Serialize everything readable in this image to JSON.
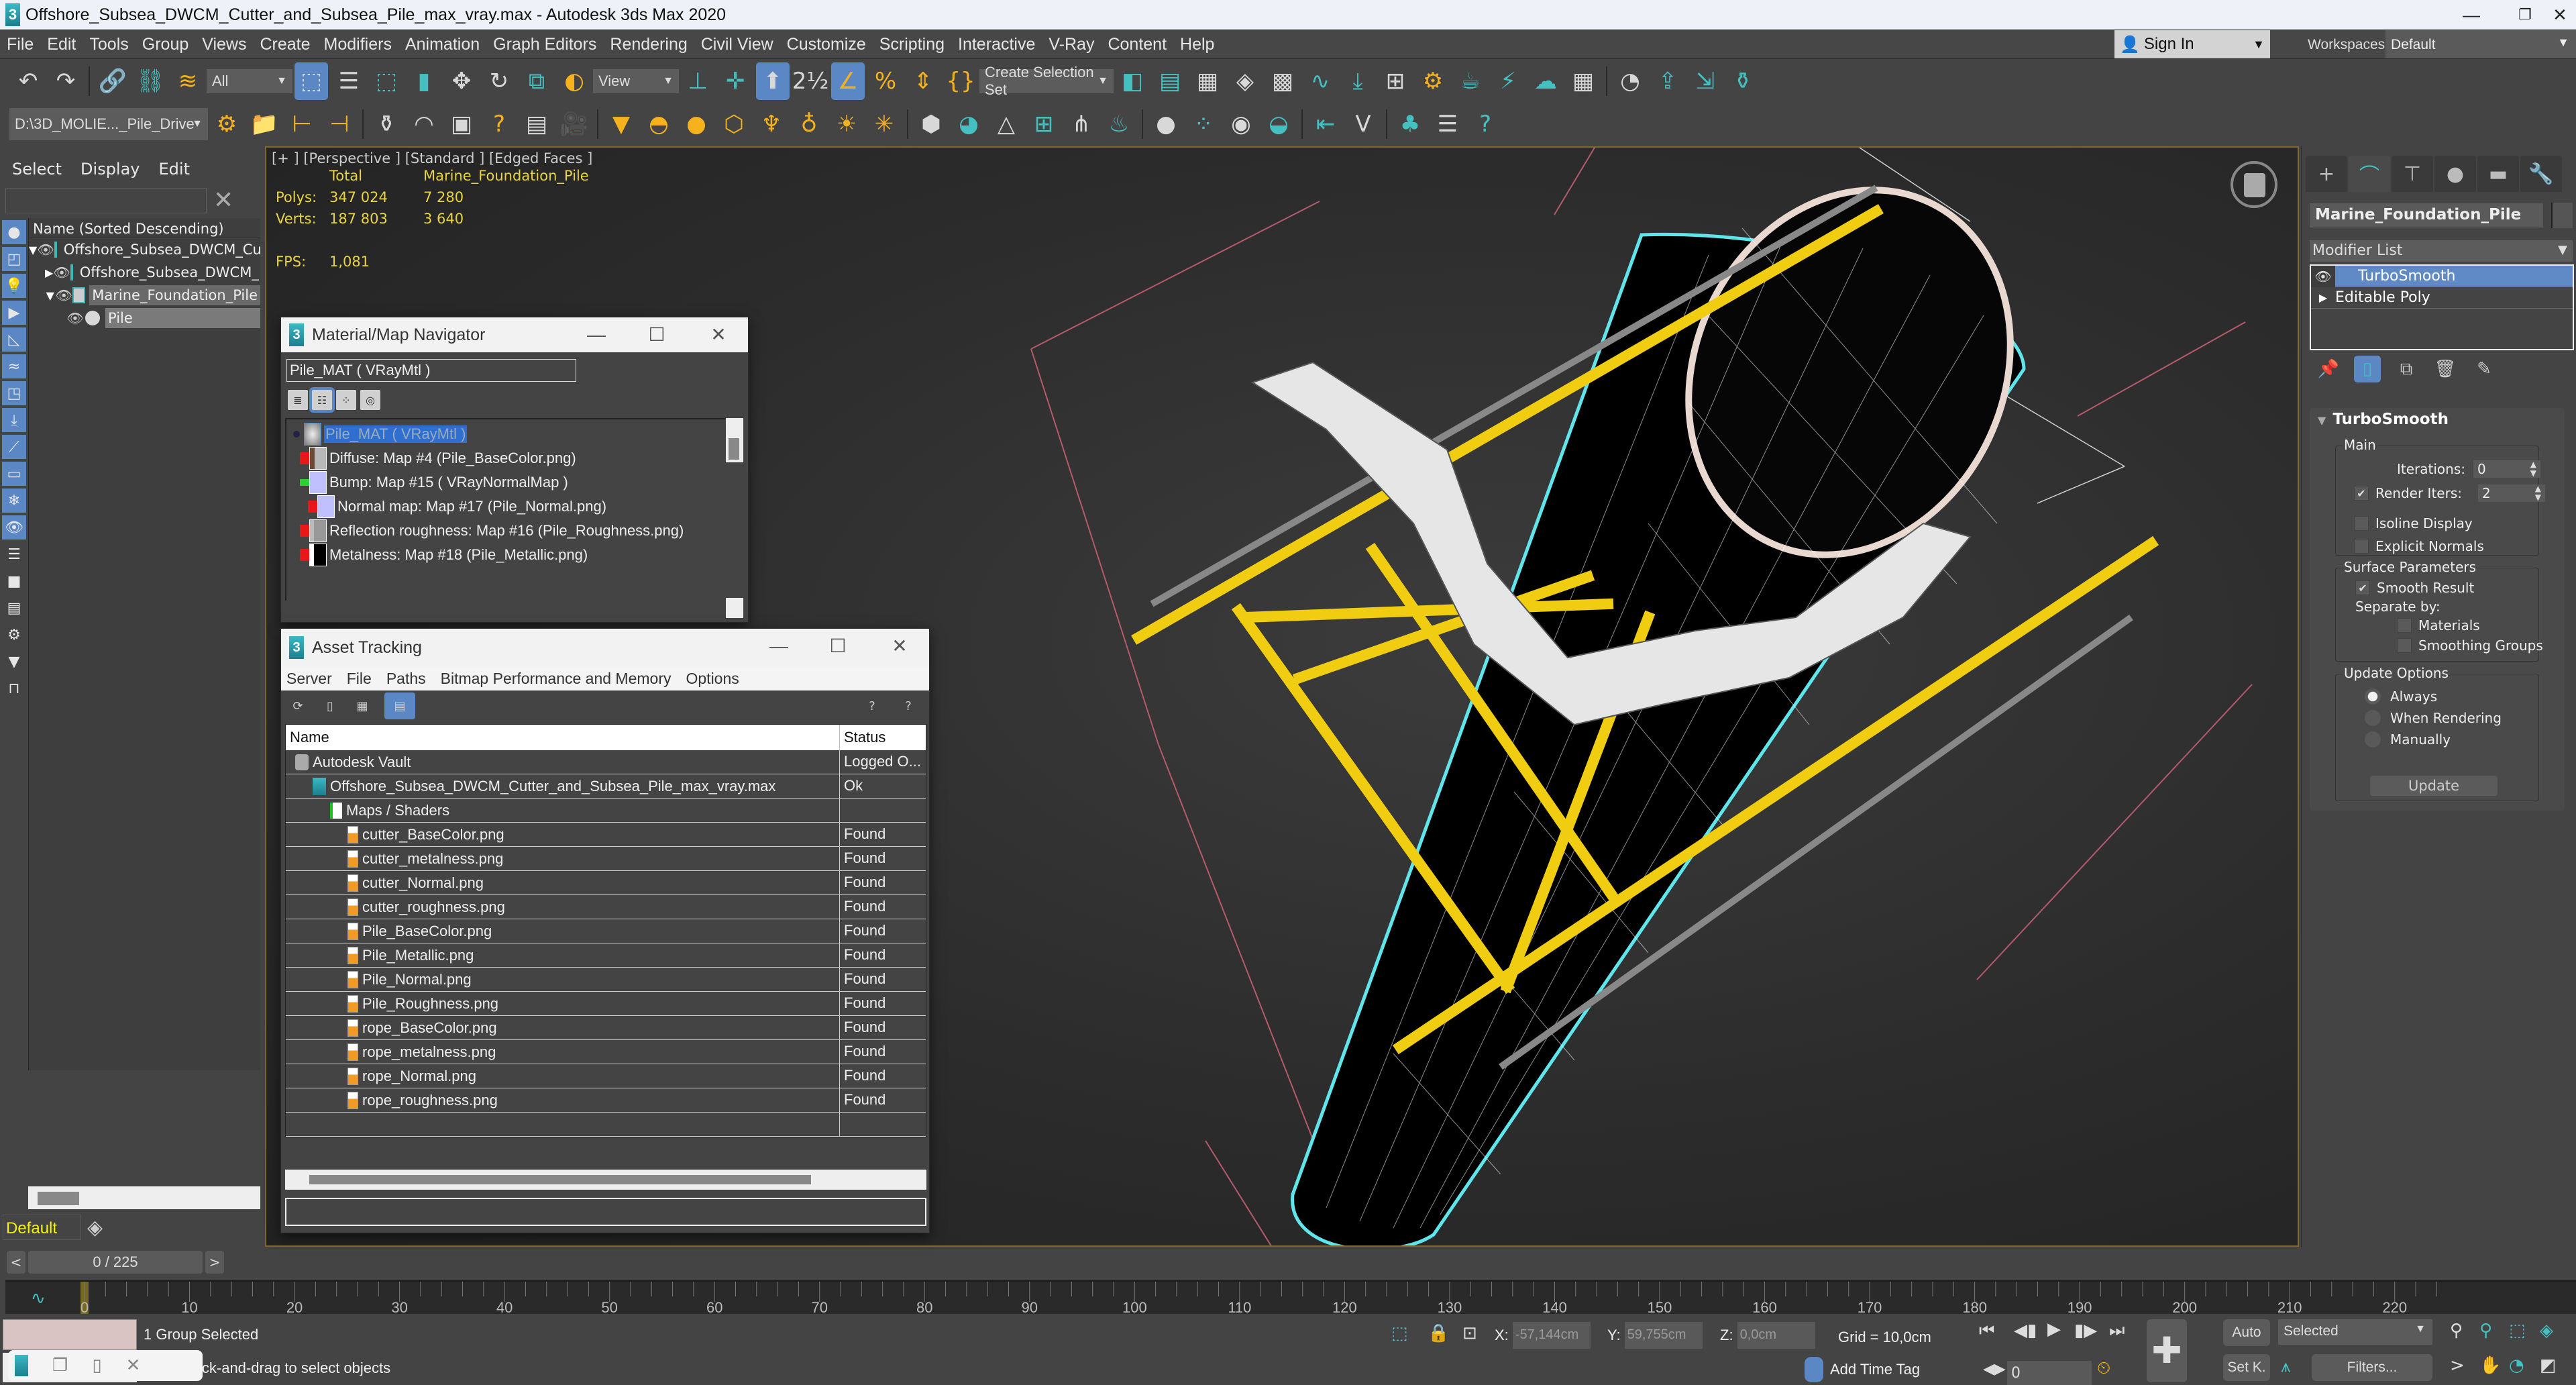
{
  "window": {
    "title": "Offshore_Subsea_DWCM_Cutter_and_Subsea_Pile_max_vray.max - Autodesk 3ds Max 2020",
    "minimize_icon": "—",
    "maximize_icon": "❐",
    "close_icon": "✕"
  },
  "menu": [
    "File",
    "Edit",
    "Tools",
    "Group",
    "Views",
    "Create",
    "Modifiers",
    "Animation",
    "Graph Editors",
    "Rendering",
    "Civil View",
    "Customize",
    "Scripting",
    "Interactive",
    "V-Ray",
    "Content",
    "Help"
  ],
  "account": {
    "sign_in": "Sign In",
    "workspaces_label": "Workspaces:",
    "workspace_value": "Default"
  },
  "toolbar1": {
    "filter_value": "All",
    "ref_coord_value": "View",
    "selection_set_value": "Create Selection Set"
  },
  "toolbar2": {
    "project_path": "D:\\3D_MOLIE..._Pile_Drive"
  },
  "scene_explorer": {
    "tabs": [
      "Select",
      "Display",
      "Edit"
    ],
    "search_placeholder": "",
    "column_header": "Name (Sorted Descending)",
    "rows": [
      {
        "name": "Offshore_Subsea_DWCM_Cu",
        "level": 0,
        "expanded": true
      },
      {
        "name": "Offshore_Subsea_DWCM_",
        "level": 1,
        "expanded": false
      },
      {
        "name": "Marine_Foundation_Pile",
        "level": 1,
        "expanded": true,
        "selected": true
      },
      {
        "name": "Pile",
        "level": 2,
        "selected": true
      }
    ],
    "layer": "Default"
  },
  "viewport": {
    "label": "[+ ] [Perspective ]  [Standard ] [Edged Faces ]",
    "stats": {
      "col_total": "Total",
      "col_object": "Marine_Foundation_Pile",
      "polys_label": "Polys:",
      "polys_total": "347 024",
      "polys_object": "7 280",
      "verts_label": "Verts:",
      "verts_total": "187 803",
      "verts_object": "3 640",
      "fps_label": "FPS:",
      "fps_value": "1,081"
    }
  },
  "material_navigator": {
    "title": "Material/Map Navigator",
    "field": "Pile_MAT  ( VRayMtl )",
    "root": "Pile_MAT  ( VRayMtl )",
    "maps": [
      {
        "label": "Diffuse: Map #4 (Pile_BaseColor.png)",
        "indent": 0,
        "swatch": "#b8b8b8"
      },
      {
        "label": "Bump: Map #15  ( VRayNormalMap )",
        "indent": 0,
        "swatch": "#c0c0ff"
      },
      {
        "label": "Normal map: Map #17 (Pile_Normal.png)",
        "indent": 1,
        "swatch": "#c0c0ff"
      },
      {
        "label": "Reflection roughness: Map #16 (Pile_Roughness.png)",
        "indent": 0,
        "swatch": "#999999"
      },
      {
        "label": "Metalness: Map #18 (Pile_Metallic.png)",
        "indent": 0,
        "swatch": "#000000"
      }
    ]
  },
  "asset_tracking": {
    "title": "Asset Tracking",
    "menu": [
      "Server",
      "File",
      "Paths",
      "Bitmap Performance and Memory",
      "Options"
    ],
    "columns": [
      "Name",
      "Status"
    ],
    "rows": [
      {
        "name": "Autodesk Vault",
        "status": "Logged O...",
        "icon": "vault",
        "indent": 0
      },
      {
        "name": "Offshore_Subsea_DWCM_Cutter_and_Subsea_Pile_max_vray.max",
        "status": "Ok",
        "icon": "max",
        "indent": 1
      },
      {
        "name": "Maps / Shaders",
        "status": "",
        "icon": "folder",
        "indent": 2
      },
      {
        "name": "cutter_BaseColor.png",
        "status": "Found",
        "icon": "png",
        "indent": 3
      },
      {
        "name": "cutter_metalness.png",
        "status": "Found",
        "icon": "png",
        "indent": 3
      },
      {
        "name": "cutter_Normal.png",
        "status": "Found",
        "icon": "png",
        "indent": 3
      },
      {
        "name": "cutter_roughness.png",
        "status": "Found",
        "icon": "png",
        "indent": 3
      },
      {
        "name": "Pile_BaseColor.png",
        "status": "Found",
        "icon": "png",
        "indent": 3
      },
      {
        "name": "Pile_Metallic.png",
        "status": "Found",
        "icon": "png",
        "indent": 3
      },
      {
        "name": "Pile_Normal.png",
        "status": "Found",
        "icon": "png",
        "indent": 3
      },
      {
        "name": "Pile_Roughness.png",
        "status": "Found",
        "icon": "png",
        "indent": 3
      },
      {
        "name": "rope_BaseColor.png",
        "status": "Found",
        "icon": "png",
        "indent": 3
      },
      {
        "name": "rope_metalness.png",
        "status": "Found",
        "icon": "png",
        "indent": 3
      },
      {
        "name": "rope_Normal.png",
        "status": "Found",
        "icon": "png",
        "indent": 3
      },
      {
        "name": "rope_roughness.png",
        "status": "Found",
        "icon": "png",
        "indent": 3
      },
      {
        "name": "",
        "status": "",
        "icon": "",
        "indent": 0
      }
    ],
    "path_field": ""
  },
  "command_panel": {
    "object_name": "Marine_Foundation_Pile",
    "modifier_list_label": "Modifier List",
    "stack": [
      {
        "name": "TurboSmooth",
        "selected": true
      },
      {
        "name": "Editable Poly",
        "selected": false
      }
    ],
    "rollout_title": "TurboSmooth",
    "main_group": "Main",
    "iterations_label": "Iterations:",
    "iterations_value": "0",
    "render_iters_label": "Render Iters:",
    "render_iters_value": "2",
    "render_iters_checked": true,
    "isoline_label": "Isoline Display",
    "explicit_normals_label": "Explicit Normals",
    "surface_group": "Surface Parameters",
    "smooth_result_label": "Smooth Result",
    "separate_by_label": "Separate by:",
    "materials_label": "Materials",
    "smoothing_groups_label": "Smoothing Groups",
    "update_group": "Update Options",
    "update_options": [
      "Always",
      "When Rendering",
      "Manually"
    ],
    "update_selected": "Always",
    "update_button": "Update",
    "check_mark": "✔"
  },
  "timeline": {
    "slider_value": "0 / 225",
    "prev": "<",
    "next": ">",
    "ticks": [
      0,
      10,
      20,
      30,
      40,
      50,
      60,
      70,
      80,
      90,
      100,
      110,
      120,
      130,
      140,
      150,
      160,
      170,
      180,
      190,
      200,
      210,
      220
    ],
    "current_frame": 0,
    "total_frames": 225
  },
  "status": {
    "selection": "1 Group Selected",
    "prompt": "ick-and-drag to select objects",
    "x_label": "X:",
    "x_value": "-57,144cm",
    "y_label": "Y:",
    "y_value": "59,755cm",
    "z_label": "Z:",
    "z_value": "0,0cm",
    "grid": "Grid = 10,0cm",
    "add_time_tag": "Add Time Tag",
    "frame_value": "0",
    "auto_key": "Auto",
    "set_key": "Set K.",
    "key_filter_select": "Selected",
    "filters": "Filters..."
  }
}
